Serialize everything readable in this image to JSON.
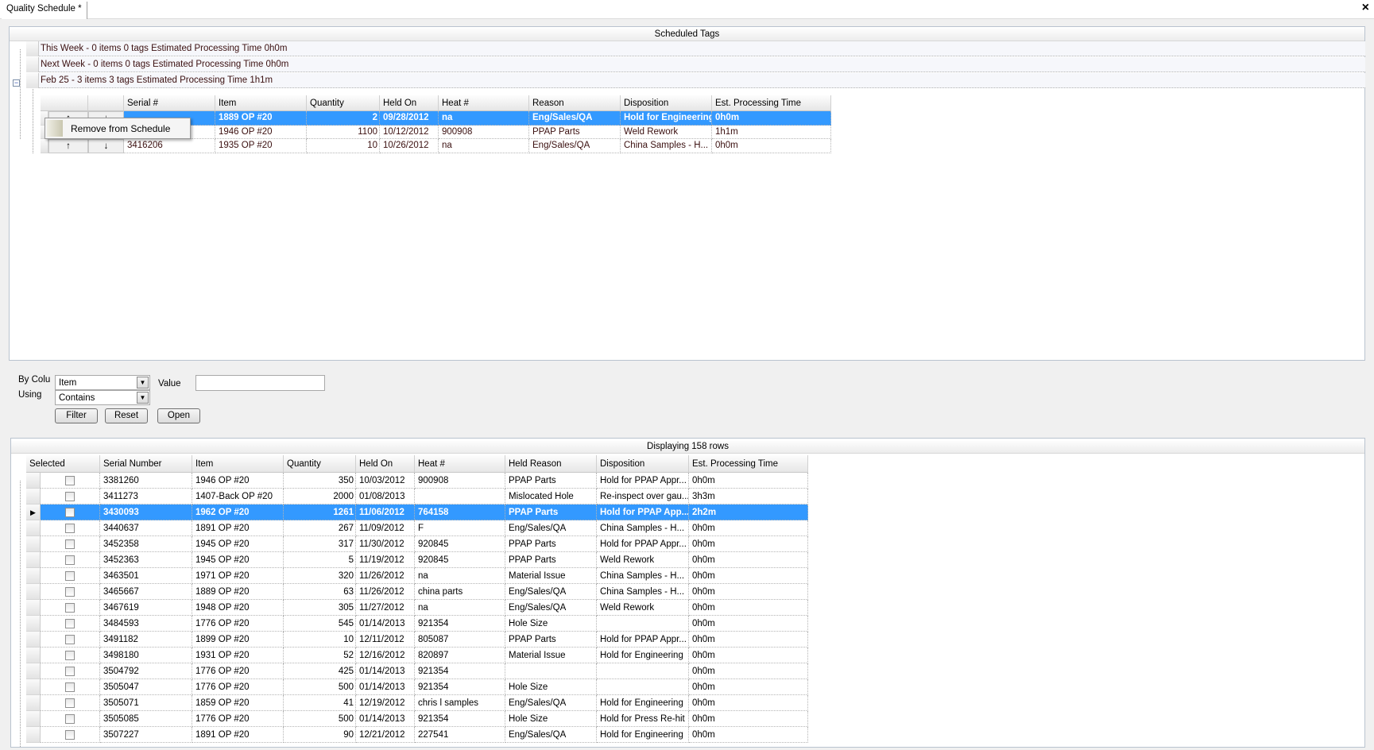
{
  "tab": {
    "title": "Quality Schedule *",
    "close": "×"
  },
  "scheduled": {
    "title": "Scheduled Tags",
    "groups": [
      {
        "label": "This Week - 0 items 0 tags  Estimated Processing Time 0h0m"
      },
      {
        "label": "Next Week - 0 items 0 tags  Estimated Processing Time 0h0m"
      },
      {
        "label": "Feb 25 - 3 items 3 tags  Estimated Processing Time 1h1m",
        "expanded": true,
        "expand_icon": "minus-box-icon"
      }
    ],
    "columns": [
      "Serial #",
      "Item",
      "Quantity",
      "Held On",
      "Heat #",
      "Reason",
      "Disposition",
      "Est. Processing Time"
    ],
    "rows": [
      {
        "selected": true,
        "cells": [
          "",
          "1889 OP #20",
          "2",
          "09/28/2012",
          "na",
          "Eng/Sales/QA",
          "Hold for Engineering",
          "0h0m"
        ]
      },
      {
        "cells": [
          "",
          "1946 OP #20",
          "1100",
          "10/12/2012",
          "900908",
          "PPAP Parts",
          "Weld Rework",
          "1h1m"
        ]
      },
      {
        "cells": [
          "3416206",
          "1935 OP #20",
          "10",
          "10/26/2012",
          "na",
          "Eng/Sales/QA",
          "China Samples - H...",
          "0h0m"
        ]
      }
    ],
    "move_up": "↑",
    "move_down": "↓"
  },
  "context_menu": {
    "items": [
      "Remove from Schedule"
    ]
  },
  "filter": {
    "by_column_label": "By Colu",
    "by_column_value": "Item",
    "using_label": "Using",
    "using_value": "Contains",
    "value_label": "Value",
    "value_input": "",
    "filter_btn": "Filter",
    "reset_btn": "Reset",
    "open_btn": "Open"
  },
  "results": {
    "status": "Displaying 158 rows",
    "columns": [
      "Selected",
      "Serial Number",
      "Item",
      "Quantity",
      "Held On",
      "Heat #",
      "Held Reason",
      "Disposition",
      "Est. Processing Time"
    ],
    "current_row": 2,
    "rows": [
      [
        "3381260",
        "1946 OP #20",
        "350",
        "10/03/2012",
        "900908",
        "PPAP Parts",
        "Hold for  PPAP Appr...",
        "0h0m"
      ],
      [
        "3411273",
        "1407-Back OP #20",
        "2000",
        "01/08/2013",
        "",
        "Mislocated Hole",
        "Re-inspect over gau...",
        "3h3m"
      ],
      [
        "3430093",
        "1962 OP #20",
        "1261",
        "11/06/2012",
        "764158",
        "PPAP Parts",
        "Hold for PPAP App...",
        "2h2m"
      ],
      [
        "3440637",
        "1891 OP #20",
        "267",
        "11/09/2012",
        "F",
        "Eng/Sales/QA",
        "China Samples - H...",
        "0h0m"
      ],
      [
        "3452358",
        "1945 OP #20",
        "317",
        "11/30/2012",
        "920845",
        "PPAP Parts",
        "Hold for  PPAP Appr...",
        "0h0m"
      ],
      [
        "3452363",
        "1945 OP #20",
        "5",
        "11/19/2012",
        "920845",
        "PPAP Parts",
        "Weld Rework",
        "0h0m"
      ],
      [
        "3463501",
        "1971 OP #20",
        "320",
        "11/26/2012",
        "na",
        "Material Issue",
        "China Samples - H...",
        "0h0m"
      ],
      [
        "3465667",
        "1889 OP #20",
        "63",
        "11/26/2012",
        "china parts",
        "Eng/Sales/QA",
        "China Samples - H...",
        "0h0m"
      ],
      [
        "3467619",
        "1948 OP #20",
        "305",
        "11/27/2012",
        "na",
        "Eng/Sales/QA",
        "Weld Rework",
        "0h0m"
      ],
      [
        "3484593",
        "1776 OP #20",
        "545",
        "01/14/2013",
        "921354",
        "Hole Size",
        "",
        "0h0m"
      ],
      [
        "3491182",
        "1899 OP #20",
        "10",
        "12/11/2012",
        "805087",
        "PPAP Parts",
        "Hold for  PPAP Appr...",
        "0h0m"
      ],
      [
        "3498180",
        "1931 OP #20",
        "52",
        "12/16/2012",
        "820897",
        "Material Issue",
        "Hold for Engineering",
        "0h0m"
      ],
      [
        "3504792",
        "1776 OP #20",
        "425",
        "01/14/2013",
        "921354",
        "",
        "",
        "0h0m"
      ],
      [
        "3505047",
        "1776 OP #20",
        "500",
        "01/14/2013",
        "921354",
        "Hole Size",
        "",
        "0h0m"
      ],
      [
        "3505071",
        "1859 OP #20",
        "41",
        "12/19/2012",
        "chris l samples",
        "Eng/Sales/QA",
        "Hold for Engineering",
        "0h0m"
      ],
      [
        "3505085",
        "1776 OP #20",
        "500",
        "01/14/2013",
        "921354",
        "Hole Size",
        "Hold for Press Re-hit",
        "0h0m"
      ],
      [
        "3507227",
        "1891 OP #20",
        "90",
        "12/21/2012",
        "227541",
        "Eng/Sales/QA",
        "Hold for Engineering",
        "0h0m"
      ]
    ]
  },
  "colors": {
    "selection": "#3399ff",
    "upper_text": "#3b1010"
  }
}
